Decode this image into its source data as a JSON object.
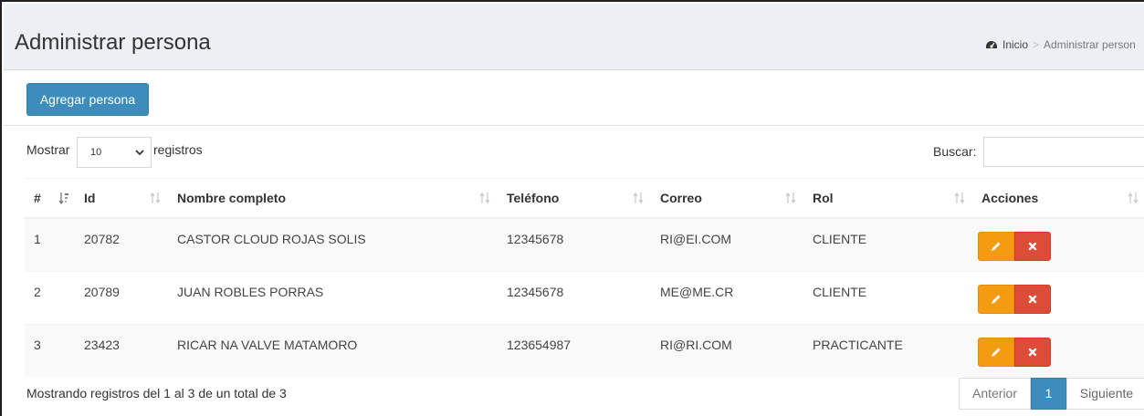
{
  "header": {
    "title": "Administrar persona",
    "breadcrumb": {
      "home_icon": "dashboard-icon",
      "home": "Inicio",
      "separator": ">",
      "current": "Administrar person"
    }
  },
  "toolbar": {
    "add_label": "Agregar persona"
  },
  "length_control": {
    "prefix": "Mostrar",
    "value": "10",
    "suffix": "registros"
  },
  "search": {
    "label": "Buscar:",
    "value": ""
  },
  "table": {
    "columns": [
      "#",
      "Id",
      "Nombre completo",
      "Teléfono",
      "Correo",
      "Rol",
      "Acciones"
    ],
    "rows": [
      {
        "num": "1",
        "id": "20782",
        "name": "CASTOR CLOUD ROJAS SOLIS",
        "phone": "12345678",
        "email": "RI@EI.COM",
        "role": "CLIENTE"
      },
      {
        "num": "2",
        "id": "20789",
        "name": "JUAN ROBLES PORRAS",
        "phone": "12345678",
        "email": "ME@ME.CR",
        "role": "CLIENTE"
      },
      {
        "num": "3",
        "id": "23423",
        "name": "RICAR NA VALVE MATAMORO",
        "phone": "123654987",
        "email": "RI@RI.COM",
        "role": "PRACTICANTE"
      }
    ],
    "action_icons": [
      "pencil-icon",
      "times-icon"
    ]
  },
  "footer": {
    "info": "Mostrando registros del 1 al 3 de un total de 3",
    "pagination": {
      "previous": "Anterior",
      "current": "1",
      "next": "Siguiente"
    }
  },
  "colors": {
    "primary": "#3c8dbc",
    "warning": "#f39c12",
    "danger": "#dd4b39",
    "header_bg": "#ecf0f5"
  }
}
